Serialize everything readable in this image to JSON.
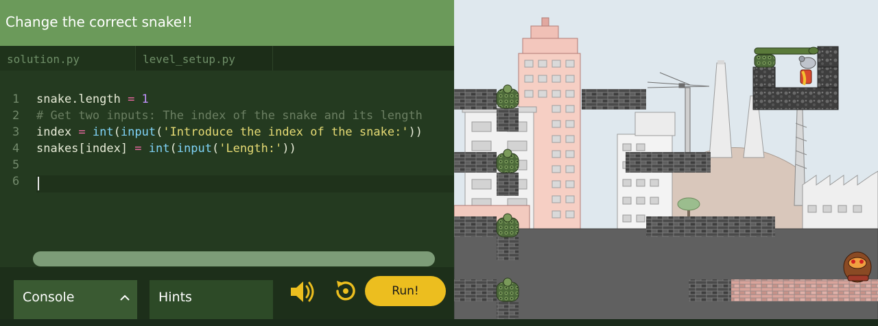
{
  "title": "Change the correct snake!!",
  "tabs": [
    {
      "label": "solution.py",
      "active": true
    },
    {
      "label": "level_setup.py",
      "active": false
    }
  ],
  "editor": {
    "line_numbers": [
      "1",
      "2",
      "3",
      "4",
      "5",
      "6"
    ],
    "lines": [
      [
        {
          "t": "snake.length ",
          "c": ""
        },
        {
          "t": "=",
          "c": "op"
        },
        {
          "t": " 1",
          "c": "num"
        }
      ],
      [
        {
          "t": "# Get two inputs: The index of the snake and its length",
          "c": "com"
        }
      ],
      [
        {
          "t": "index ",
          "c": ""
        },
        {
          "t": "=",
          "c": "op"
        },
        {
          "t": " ",
          "c": ""
        },
        {
          "t": "int",
          "c": "fn"
        },
        {
          "t": "(",
          "c": ""
        },
        {
          "t": "input",
          "c": "fn"
        },
        {
          "t": "(",
          "c": ""
        },
        {
          "t": "'Introduce the index of the snake:'",
          "c": "str"
        },
        {
          "t": "))",
          "c": ""
        }
      ],
      [
        {
          "t": "snakes[index] ",
          "c": ""
        },
        {
          "t": "=",
          "c": "op"
        },
        {
          "t": " ",
          "c": ""
        },
        {
          "t": "int",
          "c": "fn"
        },
        {
          "t": "(",
          "c": ""
        },
        {
          "t": "input",
          "c": "fn"
        },
        {
          "t": "(",
          "c": ""
        },
        {
          "t": "'Length:'",
          "c": "str"
        },
        {
          "t": "))",
          "c": ""
        }
      ],
      [],
      []
    ]
  },
  "bottom": {
    "console_label": "Console",
    "hints_label": "Hints",
    "run_label": "Run!"
  },
  "icons": {
    "sound": "speaker-icon",
    "reset": "reset-icon",
    "chevron": "chevron-up-icon"
  },
  "colors": {
    "title_bar": "#6b9a5a",
    "editor_bg": "#243a20",
    "run_button": "#ecbe1f",
    "sky": "#dfe8ee",
    "ground": "#606060"
  }
}
